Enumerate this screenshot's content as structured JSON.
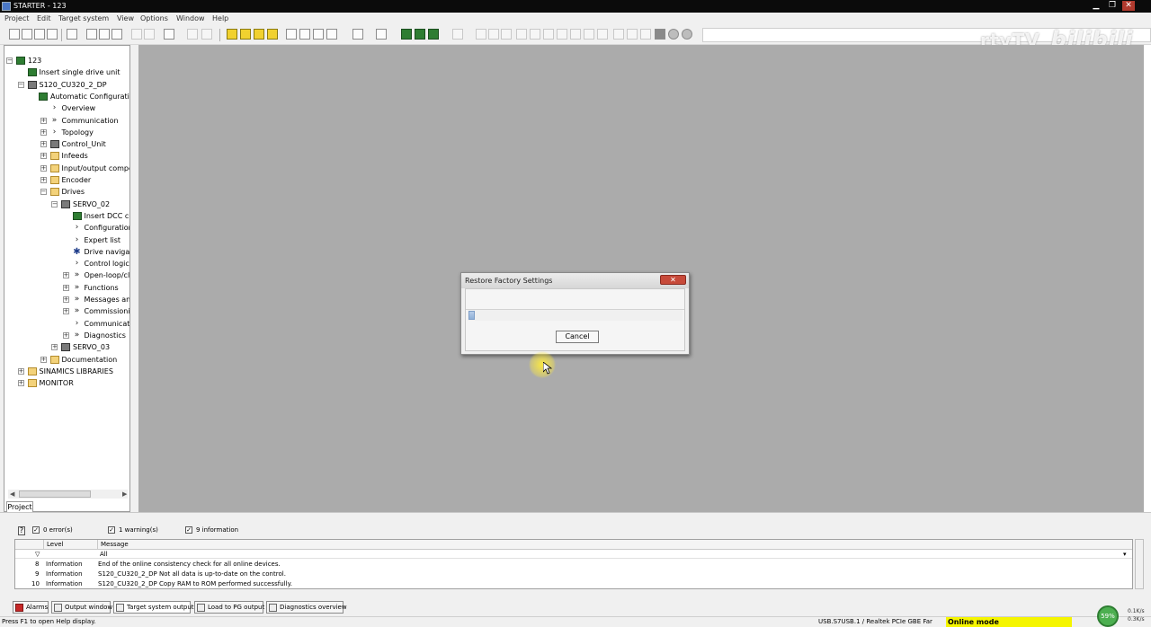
{
  "window": {
    "title": "STARTER - 123",
    "minimize": "▁",
    "restore": "❐",
    "close": "✕"
  },
  "menu": [
    "Project",
    "Edit",
    "Target system",
    "View",
    "Options",
    "Window",
    "Help"
  ],
  "watermark": {
    "left": "rtyTV",
    "right": "bilibili"
  },
  "tree": {
    "nodes": [
      {
        "label": "123",
        "icon": "project-icon"
      },
      {
        "label": "Insert single drive unit",
        "icon": "insert-icon"
      },
      {
        "label": "S120_CU320_2_DP",
        "icon": "device-icon"
      },
      {
        "label": "Automatic Configuratio",
        "icon": "config-icon"
      },
      {
        "label": "Overview",
        "icon": "chevron-icon"
      },
      {
        "label": "Communication",
        "icon": "double-chevron-icon"
      },
      {
        "label": "Topology",
        "icon": "chevron-icon"
      },
      {
        "label": "Control_Unit",
        "icon": "device-icon"
      },
      {
        "label": "Infeeds",
        "icon": "folder-icon"
      },
      {
        "label": "Input/output compone",
        "icon": "folder-icon"
      },
      {
        "label": "Encoder",
        "icon": "folder-icon"
      },
      {
        "label": "Drives",
        "icon": "folder-icon"
      },
      {
        "label": "SERVO_02",
        "icon": "device-icon"
      },
      {
        "label": "Insert DCC char",
        "icon": "insert-icon"
      },
      {
        "label": "Configuration",
        "icon": "chevron-icon"
      },
      {
        "label": "Expert list",
        "icon": "chevron-icon"
      },
      {
        "label": "Drive navigator",
        "icon": "star-icon"
      },
      {
        "label": "Control logic",
        "icon": "chevron-icon"
      },
      {
        "label": "Open-loop/clos",
        "icon": "double-chevron-icon"
      },
      {
        "label": "Functions",
        "icon": "double-chevron-icon"
      },
      {
        "label": "Messages and i",
        "icon": "double-chevron-icon"
      },
      {
        "label": "Commissioning",
        "icon": "double-chevron-icon"
      },
      {
        "label": "Communication",
        "icon": "chevron-icon"
      },
      {
        "label": "Diagnostics",
        "icon": "double-chevron-icon"
      },
      {
        "label": "SERVO_03",
        "icon": "device-icon"
      },
      {
        "label": "Documentation",
        "icon": "folder-icon"
      },
      {
        "label": "SINAMICS LIBRARIES",
        "icon": "folder-icon"
      },
      {
        "label": "MONITOR",
        "icon": "folder-icon"
      }
    ],
    "tab": "Project"
  },
  "dialog": {
    "title": "Restore Factory Settings",
    "close": "✕",
    "cancel": "Cancel",
    "progress": 0.03
  },
  "messages": {
    "filters": [
      {
        "label": "0 error(s)",
        "checked": "✓"
      },
      {
        "label": "1 warning(s)",
        "checked": "✓"
      },
      {
        "label": "9 information",
        "checked": "✓"
      }
    ],
    "columns": [
      "Level",
      "Message"
    ],
    "filter_value": "All",
    "rows": [
      {
        "num": "8",
        "level": "Information",
        "message": "End of the online consistency check for all online devices."
      },
      {
        "num": "9",
        "level": "Information",
        "message": "S120_CU320_2_DP Not all data is up-to-date on the control."
      },
      {
        "num": "10",
        "level": "Information",
        "message": "S120_CU320_2_DP Copy RAM to ROM performed successfully."
      }
    ]
  },
  "tabs": [
    "Alarms",
    "Output window",
    "Target system output",
    "Load to PG output",
    "Diagnostics overview"
  ],
  "status": {
    "help": "Press F1 to open Help display.",
    "connection": "USB.S7USB.1 / Realtek PCIe GBE Far",
    "mode": "Online mode"
  },
  "net": {
    "percent": "59%",
    "up": "0.1K/s",
    "down": "0.3K/s"
  },
  "colors": {
    "workspace": "#ababab",
    "online_mode": "#f5f500",
    "alarm_tab": "#c62828"
  }
}
